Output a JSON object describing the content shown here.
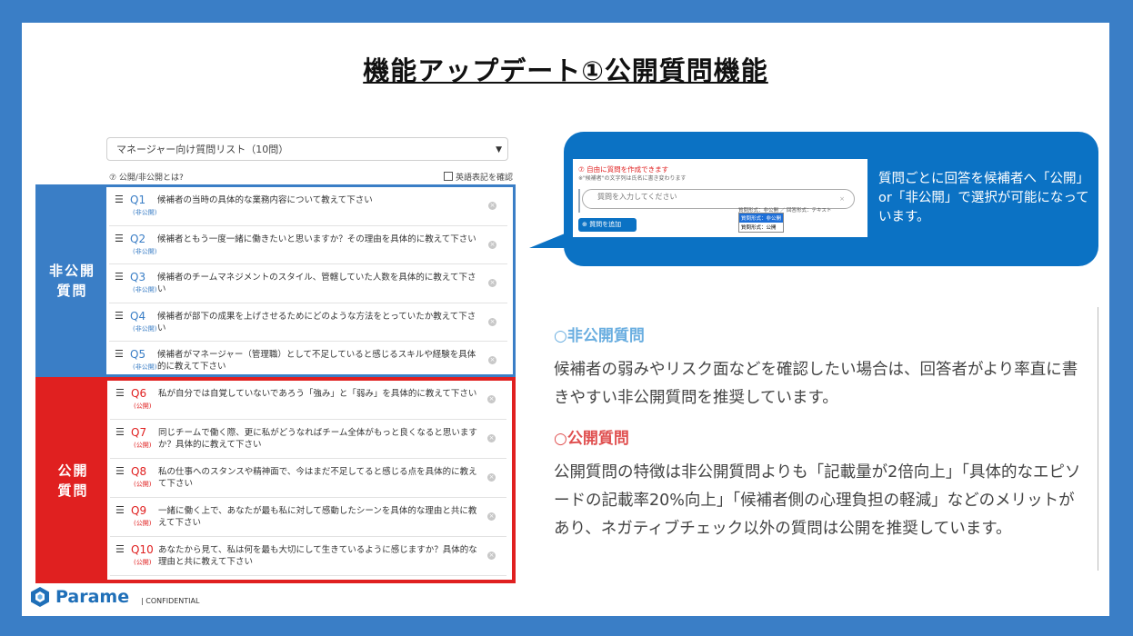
{
  "slide": {
    "title": "機能アップデート①公開質問機能"
  },
  "left": {
    "select_value": "マネージャー向け質問リスト（10問）",
    "help_text": "⑦ 公開/非公開とは?",
    "english_toggle": "英語表記を確認",
    "private_label": [
      "非公開",
      "質問"
    ],
    "public_label": [
      "公開",
      "質問"
    ],
    "private_questions": [
      {
        "num": "Q1",
        "tag": "(非公開)",
        "text": "候補者の当時の具体的な業務内容について教えて下さい"
      },
      {
        "num": "Q2",
        "tag": "(非公開)",
        "text": "候補者ともう一度一緒に働きたいと思いますか？その理由を具体的に教えて下さい"
      },
      {
        "num": "Q3",
        "tag": "(非公開)",
        "text": "候補者のチームマネジメントのスタイル、管轄していた人数を具体的に教えて下さい"
      },
      {
        "num": "Q4",
        "tag": "(非公開)",
        "text": "候補者が部下の成果を上げさせるためにどのような方法をとっていたか教えて下さい"
      },
      {
        "num": "Q5",
        "tag": "(非公開)",
        "text": "候補者がマネージャー（管理職）として不足していると感じるスキルや経験を具体的に教えて下さい"
      }
    ],
    "public_questions": [
      {
        "num": "Q6",
        "tag": "(公開)",
        "text": "私が自分では自覚していないであろう「強み」と「弱み」を具体的に教えて下さい"
      },
      {
        "num": "Q7",
        "tag": "(公開)",
        "text": "同じチームで働く際、更に私がどうなればチーム全体がもっと良くなると思いますか？具体的に教えて下さい"
      },
      {
        "num": "Q8",
        "tag": "(公開)",
        "text": "私の仕事へのスタンスや精神面で、今はまだ不足してると感じる点を具体的に教えて下さい"
      },
      {
        "num": "Q9",
        "tag": "(公開)",
        "text": "一緒に働く上で、あなたが最も私に対して感動したシーンを具体的な理由と共に教えて下さい"
      },
      {
        "num": "Q10",
        "tag": "(公開)",
        "text": "あなたから見て、私は何を最も大切にして生きているように感じますか？具体的な理由と共に教えて下さい"
      }
    ]
  },
  "callout": {
    "shot": {
      "heading": "⑦ 自由に質問を作成できます",
      "note": "※\"候補者\"の文字列は氏名に書き変わります",
      "input_placeholder": "質問を入力してください",
      "format_line": "質問形式：非公開 ／ 回答形式：テキスト",
      "dropdown": [
        "質問形式：非公開",
        "質問形式：公開"
      ],
      "add_button": "⊕ 質問を追加"
    },
    "text": "質問ごとに回答を候補者へ「公開」or「非公開」で選択が可能になっています。"
  },
  "right": {
    "private_heading": "○非公開質問",
    "private_body": "候補者の弱みやリスク面などを確認したい場合は、回答者がより率直に書きやすい非公開質問を推奨しています。",
    "public_heading": "○公開質問",
    "public_body": "公開質問の特徴は非公開質問よりも「記載量が2倍向上」「具体的なエピソードの記載率20%向上」「候補者側の心理負担の軽減」などのメリットがあり、ネガティブチェック以外の質問は公開を推奨しています。"
  },
  "footer": {
    "brand": "Parame",
    "confidential": "| CONFIDENTIAL"
  },
  "colors": {
    "blue": "#3a7ec6",
    "red": "#e02020",
    "callout": "#0b72c4"
  }
}
